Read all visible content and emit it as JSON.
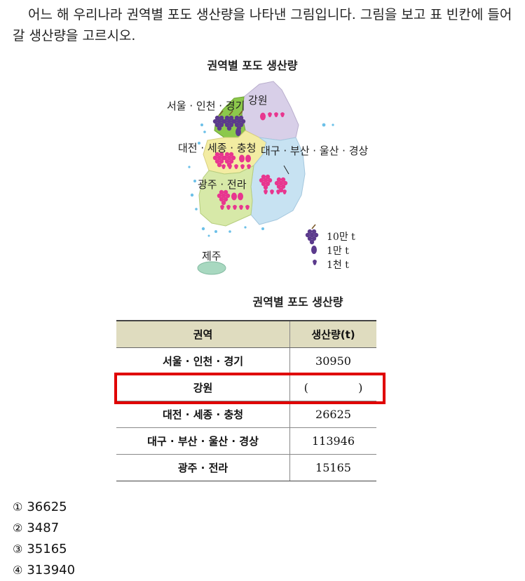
{
  "question": "어느 해 우리나라 권역별 포도 생산량을 나타낸 그림입니다. 그림을 보고 표 빈칸에 들어갈 생산량을 고르시오.",
  "map": {
    "title": "권역별 포도 생산량",
    "regions": [
      {
        "name": "서울 · 인천 · 경기",
        "color": "#8cc84b"
      },
      {
        "name": "강원",
        "color": "#d8cfe8"
      },
      {
        "name": "대전 · 세종 · 충청",
        "color": "#f3eca2"
      },
      {
        "name": "대구 · 부산 · 울산 · 경상",
        "color": "#c7e2f2"
      },
      {
        "name": "광주 · 전라",
        "color": "#d7e9a8"
      },
      {
        "name": "제주",
        "color": "#a8d8c0"
      }
    ],
    "legend": [
      {
        "label": "10만 t",
        "icon": "large-grape-icon"
      },
      {
        "label": "1만 t",
        "icon": "medium-grape-icon"
      },
      {
        "label": "1천 t",
        "icon": "small-grape-icon"
      }
    ]
  },
  "table": {
    "title": "권역별 포도 생산량",
    "headers": [
      "권역",
      "생산량(t)"
    ],
    "rows": [
      {
        "region": "서울 · 인천 · 경기",
        "value": "30950"
      },
      {
        "region": "강원",
        "value": "(              )"
      },
      {
        "region": "대전 · 세종 · 충청",
        "value": "26625"
      },
      {
        "region": "대구 · 부산 · 울산 · 경상",
        "value": "113946"
      },
      {
        "region": "광주 · 전라",
        "value": "15165"
      }
    ]
  },
  "options": [
    {
      "num": "①",
      "text": "36625"
    },
    {
      "num": "②",
      "text": "3487"
    },
    {
      "num": "③",
      "text": "35165"
    },
    {
      "num": "④",
      "text": "313940"
    }
  ],
  "colors": {
    "highlight": "#e00000",
    "header_bg": "#dfdcbf",
    "grape_large": "#5b3a8c",
    "grape_small": "#e8368f"
  }
}
